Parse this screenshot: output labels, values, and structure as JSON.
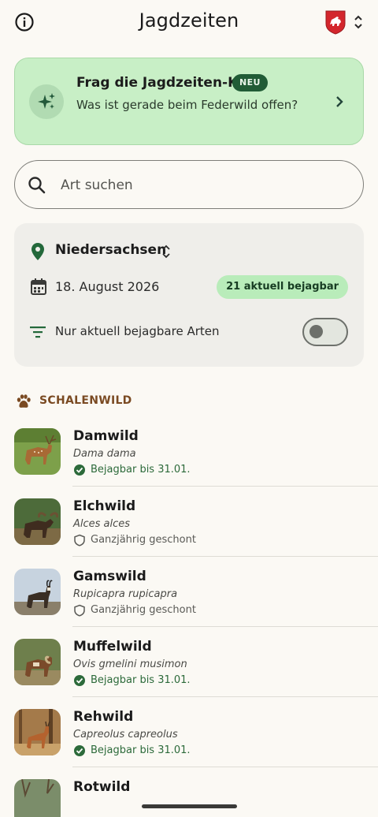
{
  "header": {
    "title": "Jagdzeiten",
    "info_icon": "info-icon",
    "state_icon": "coat-of-arms-icon",
    "switch_icon": "unfold-icon"
  },
  "ai_card": {
    "title": "Frag die Jagdzeiten-KI",
    "badge": "NEU",
    "subtitle": "Was ist gerade beim Federwild offen?",
    "icon": "sparkle-icon",
    "chevron": "chevron-right-icon"
  },
  "search": {
    "placeholder": "Art suchen",
    "value": "",
    "icon": "search-icon"
  },
  "filters": {
    "region": "Niedersachsen",
    "date": "18. August 2026",
    "count_badge": "21 aktuell bejagbar",
    "toggle_label": "Nur aktuell bejagbare Arten",
    "toggle_on": false
  },
  "section": {
    "label": "SCHALENWILD",
    "icon": "paw-icon"
  },
  "species": [
    {
      "name": "Damwild",
      "latin": "Dama dama",
      "status": "Bejagbar bis 31.01.",
      "open": true
    },
    {
      "name": "Elchwild",
      "latin": "Alces alces",
      "status": "Ganzjährig geschont",
      "open": false
    },
    {
      "name": "Gamswild",
      "latin": "Rupicapra rupicapra",
      "status": "Ganzjährig geschont",
      "open": false
    },
    {
      "name": "Muffelwild",
      "latin": "Ovis gmelini musimon",
      "status": "Bejagbar bis 31.01.",
      "open": true
    },
    {
      "name": "Rehwild",
      "latin": "Capreolus capreolus",
      "status": "Bejagbar bis 31.01.",
      "open": true
    },
    {
      "name": "Rotwild",
      "latin": "",
      "status": "",
      "open": true
    }
  ],
  "colors": {
    "background": "#fbf9f4",
    "ai_card": "#c8efc6",
    "badge_dark": "#215c36",
    "count_badge": "#b9ecba",
    "open_status": "#2c6a3a",
    "section": "#7a4a22"
  }
}
